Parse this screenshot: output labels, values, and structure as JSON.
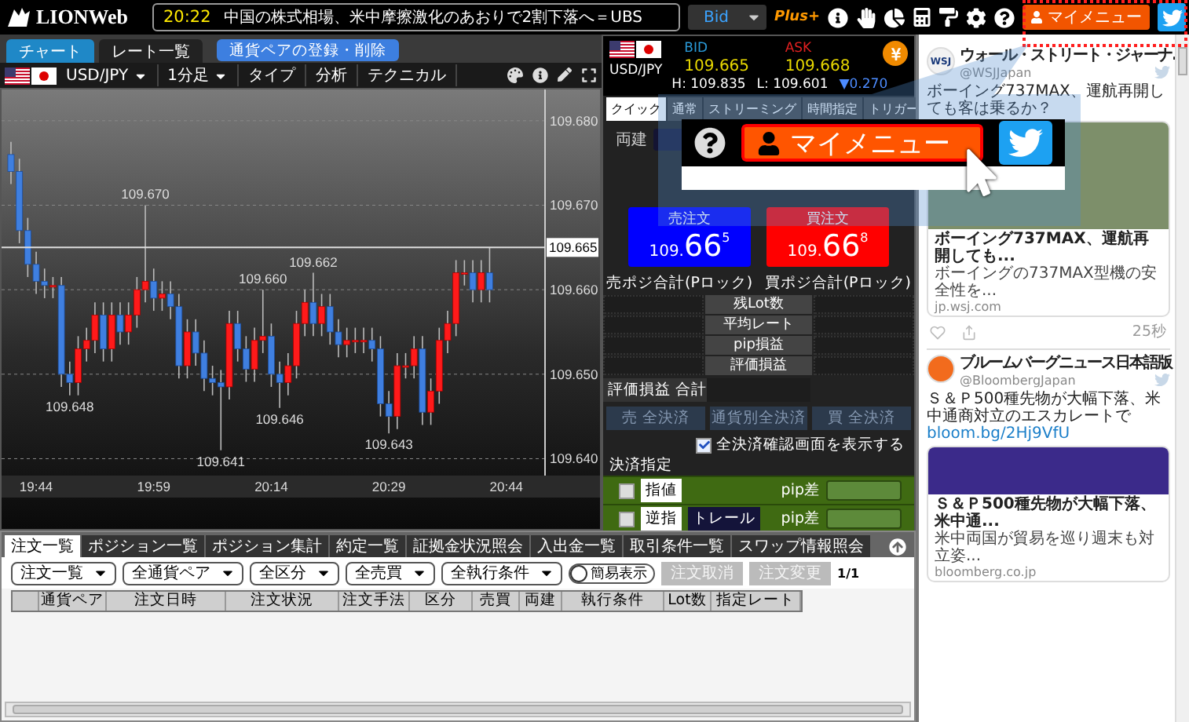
{
  "header": {
    "logo": "LIONWeb",
    "ticker_time": "20:22",
    "ticker_text": "中国の株式相場、米中摩擦激化のあおりで2割下落へ＝UBS",
    "price_mode": "Bid",
    "plus_logo": "Plus+",
    "my_menu": "マイメニュー"
  },
  "chart_panel": {
    "tabs": [
      {
        "label": "チャート",
        "selected": true
      },
      {
        "label": "レート一覧",
        "selected": false
      }
    ],
    "register_button": "通貨ペアの登録・削除",
    "pair": "USD/JPY",
    "timeframe": "1分足",
    "type_label": "タイプ",
    "analysis_label": "分析",
    "technical_label": "テクニカル",
    "chart_data": {
      "type": "candlestick",
      "grid": true,
      "ylim": [
        109.638,
        109.6837
      ],
      "categories": [
        null,
        null,
        null,
        "19:44",
        null,
        null,
        null,
        null,
        null,
        null,
        null,
        null,
        null,
        null,
        null,
        null,
        null,
        "19:59",
        null,
        null,
        null,
        null,
        null,
        null,
        null,
        null,
        null,
        null,
        null,
        null,
        null,
        "20:14",
        null,
        null,
        null,
        null,
        null,
        null,
        null,
        null,
        null,
        null,
        null,
        null,
        null,
        "20:29",
        null,
        null,
        null,
        null,
        null,
        null,
        null,
        null,
        null,
        null,
        null,
        null,
        null,
        "20:44"
      ],
      "ohlc": [
        [
          109.676,
          109.6775,
          109.6725,
          109.674
        ],
        [
          109.674,
          109.6755,
          109.6655,
          109.667
        ],
        [
          109.667,
          109.6685,
          109.6615,
          109.663
        ],
        [
          109.663,
          109.6645,
          109.6595,
          109.661
        ],
        [
          109.661,
          109.6625,
          109.659,
          109.6605
        ],
        [
          109.6605,
          109.6615,
          109.659,
          109.6605
        ],
        [
          109.6605,
          109.6615,
          109.6485,
          109.65
        ],
        [
          109.65,
          109.6515,
          109.6475,
          109.649
        ],
        [
          109.649,
          109.6545,
          109.6475,
          109.653
        ],
        [
          109.653,
          109.6555,
          109.6515,
          109.654
        ],
        [
          109.654,
          109.6585,
          109.6525,
          109.657
        ],
        [
          109.657,
          109.6585,
          109.6515,
          109.653
        ],
        [
          109.653,
          109.6585,
          109.6515,
          109.657
        ],
        [
          109.657,
          109.6585,
          109.6535,
          109.655
        ],
        [
          109.655,
          109.6585,
          109.6535,
          109.657
        ],
        [
          109.657,
          109.6615,
          109.6555,
          109.66
        ],
        [
          109.66,
          109.67,
          109.6585,
          109.661
        ],
        [
          109.661,
          109.6625,
          109.6575,
          109.659
        ],
        [
          109.659,
          109.661,
          109.6575,
          109.6595
        ],
        [
          109.6595,
          109.661,
          109.6565,
          109.658
        ],
        [
          109.658,
          109.6595,
          109.6495,
          109.651
        ],
        [
          109.651,
          109.6565,
          109.6495,
          109.655
        ],
        [
          109.655,
          109.6565,
          109.651,
          109.6525
        ],
        [
          109.6525,
          109.654,
          109.648,
          109.6495
        ],
        [
          109.6495,
          109.651,
          109.6475,
          109.649
        ],
        [
          109.649,
          109.6505,
          109.641,
          109.6485
        ],
        [
          109.6485,
          109.6575,
          109.647,
          109.656
        ],
        [
          109.656,
          109.6575,
          109.6515,
          109.653
        ],
        [
          109.653,
          109.6545,
          109.6491,
          109.6506
        ],
        [
          109.6506,
          109.6555,
          109.6491,
          109.654
        ],
        [
          109.654,
          109.66,
          109.6525,
          109.6545
        ],
        [
          109.6545,
          109.656,
          109.6485,
          109.65
        ],
        [
          109.65,
          109.6515,
          109.646,
          109.649
        ],
        [
          109.649,
          109.6525,
          109.6475,
          109.651
        ],
        [
          109.651,
          109.6575,
          109.6495,
          109.656
        ],
        [
          109.656,
          109.66,
          109.6545,
          109.6585
        ],
        [
          109.6585,
          109.662,
          109.6545,
          109.656
        ],
        [
          109.656,
          109.6595,
          109.6545,
          109.658
        ],
        [
          109.658,
          109.6595,
          109.6535,
          109.655
        ],
        [
          109.655,
          109.6565,
          109.652,
          109.6535
        ],
        [
          109.6535,
          109.6555,
          109.652,
          109.654
        ],
        [
          109.654,
          109.6555,
          109.6525,
          109.654
        ],
        [
          109.654,
          109.6555,
          109.6525,
          109.654
        ],
        [
          109.654,
          109.6555,
          109.6515,
          109.653
        ],
        [
          109.653,
          109.6545,
          109.645,
          109.6465
        ],
        [
          109.6465,
          109.648,
          109.643,
          109.645
        ],
        [
          109.645,
          109.6525,
          109.6435,
          109.651
        ],
        [
          109.651,
          109.6525,
          109.6495,
          109.651
        ],
        [
          109.651,
          109.6545,
          109.6495,
          109.653
        ],
        [
          109.653,
          109.6545,
          109.644,
          109.6455
        ],
        [
          109.6455,
          109.6495,
          109.644,
          109.648
        ],
        [
          109.648,
          109.6555,
          109.6465,
          109.654
        ],
        [
          109.654,
          109.6575,
          109.6525,
          109.656
        ],
        [
          109.656,
          109.6635,
          109.6545,
          109.662
        ],
        [
          109.662,
          109.6635,
          109.6605,
          109.662
        ],
        [
          109.662,
          109.6635,
          109.6585,
          109.66
        ],
        [
          109.66,
          109.6635,
          109.6585,
          109.662
        ],
        [
          109.662,
          109.665,
          109.6585,
          109.66
        ],
        null,
        null
      ],
      "yticks": [
        {
          "value": 109.68,
          "label": "109.680"
        },
        {
          "value": 109.67,
          "label": "109.670"
        },
        {
          "value": 109.66,
          "label": "109.660"
        },
        {
          "value": 109.65,
          "label": "109.650"
        },
        {
          "value": 109.64,
          "label": "109.640"
        }
      ],
      "annotations": [
        {
          "y": 109.67,
          "text": "109.670"
        },
        {
          "y": 109.6475,
          "text": "109.648"
        },
        {
          "y": 109.641,
          "text": "109.641"
        },
        {
          "y": 109.66,
          "text": "109.660"
        },
        {
          "y": 109.662,
          "text": "109.662"
        },
        {
          "y": 109.646,
          "text": "109.646"
        },
        {
          "y": 109.643,
          "text": "109.643"
        }
      ],
      "ref_lines": [
        {
          "axis": "y",
          "value": 109.665,
          "label": "109.665"
        }
      ]
    }
  },
  "rate_panel": {
    "pair": "USD/JPY",
    "bid_label": "BID",
    "bid": "109.665",
    "ask_label": "ASK",
    "ask": "109.668",
    "high": "H: 109.835",
    "low": "L: 109.601",
    "change": "▼0.270",
    "order_tabs": [
      {
        "label": "クイック",
        "selected": true
      },
      {
        "label": "通常",
        "selected": false
      },
      {
        "label": "ストリーミング",
        "selected": false
      },
      {
        "label": "時間指定",
        "selected": false
      },
      {
        "label": "トリガー",
        "selected": false
      }
    ],
    "hedge_label": "両建",
    "sell": {
      "label": "売注文",
      "price_head": "109.",
      "price_big": "66",
      "price_sup": "5"
    },
    "buy": {
      "label": "買注文",
      "price_head": "109.",
      "price_big": "66",
      "price_sup": "8"
    },
    "sell_total": "売ポジ合計(Pロック)",
    "buy_total": "買ポジ合計(Pロック)",
    "summary_rows": [
      "残Lot数",
      "平均レート",
      "pip損益",
      "評価損益"
    ],
    "total_label": "評価損益 合計",
    "settle_buttons": [
      {
        "label": "売 全決済",
        "disabled": true
      },
      {
        "label": "通貨別全決済",
        "disabled": true
      },
      {
        "label": "買 全決済",
        "disabled": true
      }
    ],
    "confirm": {
      "label": "全決済確認画面を表示する",
      "checked": true
    },
    "settle_title": "決済指定",
    "settle_rows": [
      {
        "checked": false,
        "labels": [
          "指値"
        ],
        "pip_label": "pip差"
      },
      {
        "checked": false,
        "labels": [
          "逆指",
          "トレール"
        ],
        "pip_label": "pip差"
      }
    ]
  },
  "callout": {
    "my_menu": "マイメニュー"
  },
  "tweets": [
    {
      "author": "ウォール・ストリート・ジャーナ.",
      "avatar_text": "WSJ",
      "handle": "@WSJJapan",
      "text": "ボーイング737MAX、運航再開しても客は乗るか？",
      "card_title": "ボーイング737MAX、運航再開しても...",
      "card_desc": "ボーイングの737MAX型機の安全性を...",
      "card_domain": "jp.wsj.com",
      "time": "25秒"
    },
    {
      "author": "ブルームバーグニュース日本語版",
      "handle": "@BloombergJapan",
      "text": "Ｓ＆Ｐ500種先物が大幅下落、米中通商対立のエスカレートで",
      "link": "bloom.bg/2Hj9VfU",
      "card_title": "Ｓ＆Ｐ500種先物が大幅下落、米中通...",
      "card_desc": "米中両国が貿易を巡り週末も対立姿...",
      "card_domain": "bloomberg.co.jp"
    }
  ],
  "orders": {
    "tabs": [
      {
        "label": "注文一覧",
        "selected": true
      },
      {
        "label": "ポジション一覧",
        "selected": false
      },
      {
        "label": "ポジション集計",
        "selected": false
      },
      {
        "label": "約定一覧",
        "selected": false
      },
      {
        "label": "証拠金状況照会",
        "selected": false
      },
      {
        "label": "入出金一覧",
        "selected": false
      },
      {
        "label": "取引条件一覧",
        "selected": false
      },
      {
        "label": "スワップ情報照会",
        "selected": false
      }
    ],
    "filters": [
      "注文一覧",
      "全通貨ペア",
      "全区分",
      "全売買",
      "全執行条件"
    ],
    "toggle": {
      "label": "簡易表示",
      "on": false
    },
    "buttons": [
      {
        "label": "注文取消",
        "disabled": true
      },
      {
        "label": "注文変更",
        "disabled": true
      }
    ],
    "page": "1/1",
    "columns": [
      "通貨ペア",
      "注文日時",
      "注文状況",
      "注文手法",
      "区分",
      "売買",
      "両建",
      "執行条件",
      "Lot数",
      "指定レート"
    ]
  }
}
